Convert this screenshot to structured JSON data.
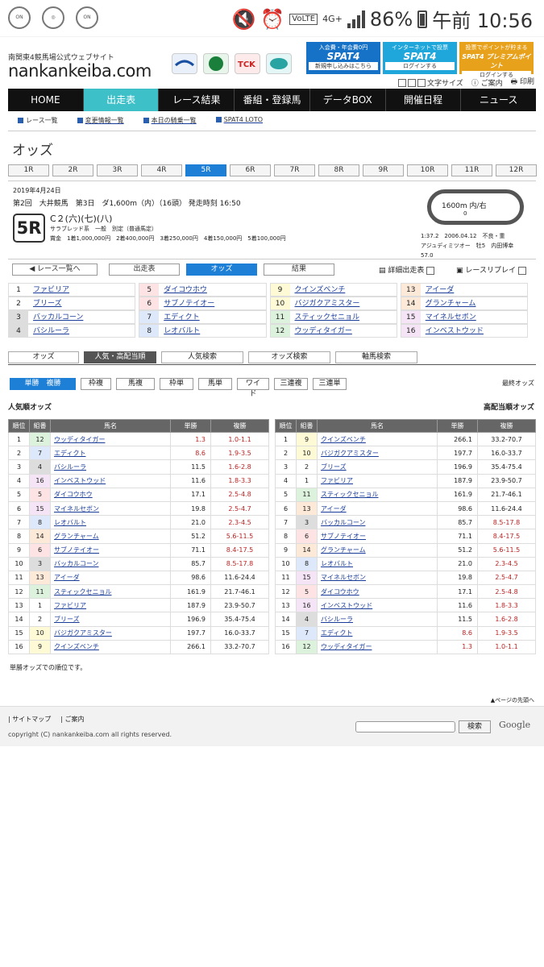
{
  "status": {
    "net": "4G+",
    "battery": "86%",
    "time": "午前 10:56",
    "volte": "VoLTE",
    "icon1": "ON",
    "icon2": "ON"
  },
  "header": {
    "site_sub": "南関東4競馬場公式ウェブサイト",
    "site_name": "nankankeiba.com",
    "spat": [
      {
        "top": "入会費・年会費0円",
        "logo": "SPAT4",
        "bottom": "新規申し込みはこちら",
        "color": "#1672c6"
      },
      {
        "top": "インターネットで投票",
        "logo": "SPAT4",
        "bottom": "ログインする",
        "color": "#1fa6db"
      },
      {
        "top": "投票でポイントが貯まる",
        "logo": "SPAT4 プレミアムポイント",
        "bottom": "ログインする",
        "color": "#e8a11a"
      }
    ],
    "tools": [
      "文字サイズ",
      "ご案内",
      "印刷"
    ]
  },
  "nav": [
    "HOME",
    "出走表",
    "レース結果",
    "番組・登録馬",
    "データBOX",
    "開催日程",
    "ニュース"
  ],
  "subnav": [
    "レース一覧",
    "変更情報一覧",
    "本日の騎乗一覧",
    "SPAT4 LOTO"
  ],
  "page_title": "オッズ",
  "race_tabs": [
    "1R",
    "2R",
    "3R",
    "4R",
    "5R",
    "6R",
    "7R",
    "8R",
    "9R",
    "10R",
    "11R",
    "12R"
  ],
  "race": {
    "date": "2019年4月24日",
    "line": "第2回　大井競馬　第3日　ダ1,600m（内）（16頭）  発走時刻 16:50",
    "num": "5R",
    "class": "C２(六)(七)(八)",
    "detail": "サラブレッド系　一般　別定（普通馬定）",
    "prize": "賞金　1着1,000,000円　2着400,000円　3着250,000円　4着150,000円　5着100,000円",
    "track": "1600m 内/右",
    "zero": "0",
    "record": [
      "1:37.2　2006.04.12　不良・重",
      "アジュディミツオー　牡5　内田博幸",
      "57.0"
    ]
  },
  "links": {
    "back": "レース一覧へ",
    "card": "出走表",
    "odds": "オッズ",
    "result": "結果",
    "detail": "詳細出走表",
    "replay": "レースリプレイ"
  },
  "horses": [
    {
      "n": "1",
      "name": "ファビリア",
      "c": "#fff"
    },
    {
      "n": "2",
      "name": "ブリーズ",
      "c": "#fff"
    },
    {
      "n": "3",
      "name": "バッカルコーン",
      "c": "#ddd"
    },
    {
      "n": "4",
      "name": "バシルーラ",
      "c": "#ddd"
    },
    {
      "n": "5",
      "name": "ダイコウホウ",
      "c": "#fde3e3"
    },
    {
      "n": "6",
      "name": "サブノテイオー",
      "c": "#fde3e3"
    },
    {
      "n": "7",
      "name": "エディクト",
      "c": "#dde9fb"
    },
    {
      "n": "8",
      "name": "レオバルト",
      "c": "#dde9fb"
    },
    {
      "n": "9",
      "name": "クインズベンチ",
      "c": "#fdfad5"
    },
    {
      "n": "10",
      "name": "バジガクアミスター",
      "c": "#fdfad5"
    },
    {
      "n": "11",
      "name": "スティックセニョル",
      "c": "#ddf2dd"
    },
    {
      "n": "12",
      "name": "ウッディタイガー",
      "c": "#ddf2dd"
    },
    {
      "n": "13",
      "name": "アイーダ",
      "c": "#fde9d8"
    },
    {
      "n": "14",
      "name": "グランチャーム",
      "c": "#fde9d8"
    },
    {
      "n": "15",
      "name": "マイネルセボン",
      "c": "#f5e4f5"
    },
    {
      "n": "16",
      "name": "インベストウッド",
      "c": "#f5e4f5"
    }
  ],
  "odds_tabs": [
    "オッズ",
    "人気・高配当順",
    "人気検索",
    "オッズ検索",
    "軸馬検索"
  ],
  "bet_tabs": [
    "単勝　複勝",
    "枠複",
    "馬複",
    "枠単",
    "馬単",
    "ワイド",
    "三連複",
    "三連単"
  ],
  "latest": "最終オッズ",
  "left_title": "人気順オッズ",
  "right_title": "高配当順オッズ",
  "cols": [
    "順位",
    "組番",
    "馬名",
    "単勝",
    "複勝"
  ],
  "left_rows": [
    [
      "1",
      "12",
      "ウッディタイガー",
      "1.3",
      "1.0-1.1"
    ],
    [
      "2",
      "7",
      "エディクト",
      "8.6",
      "1.9-3.5"
    ],
    [
      "3",
      "4",
      "バシルーラ",
      "11.5",
      "1.6-2.8"
    ],
    [
      "4",
      "16",
      "インベストウッド",
      "11.6",
      "1.8-3.3"
    ],
    [
      "5",
      "5",
      "ダイコウホウ",
      "17.1",
      "2.5-4.8"
    ],
    [
      "6",
      "15",
      "マイネルセボン",
      "19.8",
      "2.5-4.7"
    ],
    [
      "7",
      "8",
      "レオバルト",
      "21.0",
      "2.3-4.5"
    ],
    [
      "8",
      "14",
      "グランチャーム",
      "51.2",
      "5.6-11.5"
    ],
    [
      "9",
      "6",
      "サブノテイオー",
      "71.1",
      "8.4-17.5"
    ],
    [
      "10",
      "3",
      "バッカルコーン",
      "85.7",
      "8.5-17.8"
    ],
    [
      "11",
      "13",
      "アイーダ",
      "98.6",
      "11.6-24.4"
    ],
    [
      "12",
      "11",
      "スティックセニョル",
      "161.9",
      "21.7-46.1"
    ],
    [
      "13",
      "1",
      "ファビリア",
      "187.9",
      "23.9-50.7"
    ],
    [
      "14",
      "2",
      "ブリーズ",
      "196.9",
      "35.4-75.4"
    ],
    [
      "15",
      "10",
      "バジガクアミスター",
      "197.7",
      "16.0-33.7"
    ],
    [
      "16",
      "9",
      "クインズベンチ",
      "266.1",
      "33.2-70.7"
    ]
  ],
  "right_rows": [
    [
      "1",
      "9",
      "クインズベンチ",
      "266.1",
      "33.2-70.7"
    ],
    [
      "2",
      "10",
      "バジガクアミスター",
      "197.7",
      "16.0-33.7"
    ],
    [
      "3",
      "2",
      "ブリーズ",
      "196.9",
      "35.4-75.4"
    ],
    [
      "4",
      "1",
      "ファビリア",
      "187.9",
      "23.9-50.7"
    ],
    [
      "5",
      "11",
      "スティックセニョル",
      "161.9",
      "21.7-46.1"
    ],
    [
      "6",
      "13",
      "アイーダ",
      "98.6",
      "11.6-24.4"
    ],
    [
      "7",
      "3",
      "バッカルコーン",
      "85.7",
      "8.5-17.8"
    ],
    [
      "8",
      "6",
      "サブノテイオー",
      "71.1",
      "8.4-17.5"
    ],
    [
      "9",
      "14",
      "グランチャーム",
      "51.2",
      "5.6-11.5"
    ],
    [
      "10",
      "8",
      "レオバルト",
      "21.0",
      "2.3-4.5"
    ],
    [
      "11",
      "15",
      "マイネルセボン",
      "19.8",
      "2.5-4.7"
    ],
    [
      "12",
      "5",
      "ダイコウホウ",
      "17.1",
      "2.5-4.8"
    ],
    [
      "13",
      "16",
      "インベストウッド",
      "11.6",
      "1.8-3.3"
    ],
    [
      "14",
      "4",
      "バシルーラ",
      "11.5",
      "1.6-2.8"
    ],
    [
      "15",
      "7",
      "エディクト",
      "8.6",
      "1.9-3.5"
    ],
    [
      "16",
      "12",
      "ウッディタイガー",
      "1.3",
      "1.0-1.1"
    ]
  ],
  "note": "単勝オッズでの順位です。",
  "page_top": "ページの先頭へ",
  "footer": {
    "links": [
      "サイトマップ",
      "ご案内"
    ],
    "copy": "copyright (C) nankankeiba.com all rights reserved.",
    "search_btn": "検索",
    "google": "Google"
  }
}
